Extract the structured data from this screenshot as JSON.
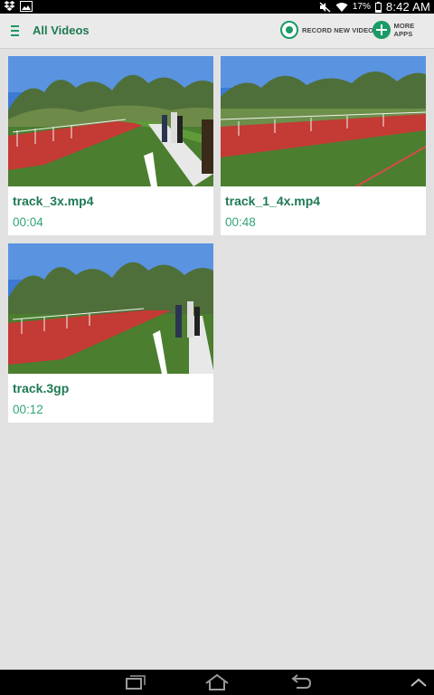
{
  "status_bar": {
    "left_icons": [
      "dropbox-icon",
      "image-icon"
    ],
    "right_icons": [
      "mute-icon",
      "wifi-icon",
      "battery-icon"
    ],
    "battery": "17%",
    "time": "8:42 AM"
  },
  "action_bar": {
    "menu_icon": "menu-icon",
    "title": "All Videos",
    "record_label": "RECORD NEW VIDEO",
    "more_apps_label": "MORE APPS"
  },
  "videos": [
    {
      "name": "track_3x.mp4",
      "duration": "00:04"
    },
    {
      "name": "track_1_4x.mp4",
      "duration": "00:48"
    },
    {
      "name": "track.3gp",
      "duration": "00:12"
    }
  ],
  "nav_bar": {
    "icons": [
      "recent-apps-icon",
      "home-icon",
      "back-icon",
      "chevron-up-icon"
    ]
  },
  "colors": {
    "accent": "#1a9a66",
    "title_green": "#1e7a52",
    "duration_green": "#34a474",
    "background": "#e1e1e1"
  }
}
